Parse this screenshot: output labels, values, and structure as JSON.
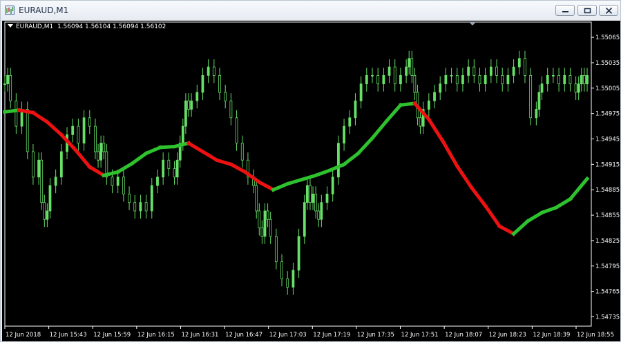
{
  "window": {
    "title": "EURAUD,M1",
    "icon": "chart-window-icon",
    "buttons": [
      "minimize",
      "restore",
      "close"
    ]
  },
  "chart_header": {
    "symbol": "EURAUD,M1",
    "ohlc": "1.56094 1.56104 1.56094 1.56102"
  },
  "colors": {
    "background": "#000000",
    "candles": "#66e066",
    "ma_up": "#2ec22e",
    "ma_down": "#ee1111",
    "axis": "#ffffff"
  },
  "chart_data": {
    "type": "line",
    "title": "",
    "xlabel": "",
    "ylabel": "",
    "ylim": [
      1.54724,
      1.55083
    ],
    "x_tick_labels": [
      "12 Jun 2018",
      "12 Jun 15:43",
      "12 Jun 15:59",
      "12 Jun 16:15",
      "12 Jun 16:31",
      "12 Jun 16:47",
      "12 Jun 17:03",
      "12 Jun 17:19",
      "12 Jun 17:35",
      "12 Jun 17:51",
      "12 Jun 18:07",
      "12 Jun 18:23",
      "12 Jun 18:39",
      "12 Jun 18:55"
    ],
    "y_tick_labels": [
      "1.55065",
      "1.55035",
      "1.55005",
      "1.54975",
      "1.54945",
      "1.54915",
      "1.54885",
      "1.54855",
      "1.54825",
      "1.54795",
      "1.54765",
      "1.54735"
    ],
    "series": [
      {
        "x": [
          0,
          2,
          4,
          8,
          12,
          16,
          20,
          24,
          26,
          28,
          30,
          32,
          36,
          40,
          44,
          48,
          52,
          56,
          60,
          64,
          66,
          68,
          70,
          72,
          76,
          80,
          84,
          88,
          92,
          96,
          100,
          104,
          108,
          112,
          116,
          120,
          122,
          124,
          126,
          128,
          130,
          132,
          136,
          140,
          144,
          148,
          152,
          156,
          160,
          164,
          168,
          172,
          176,
          178,
          180,
          182,
          184,
          186,
          188,
          192,
          196,
          200,
          204,
          208,
          212,
          214,
          216,
          218,
          220,
          222,
          224,
          228,
          232,
          236,
          240,
          244,
          248,
          252,
          256,
          260,
          264,
          268,
          272,
          276,
          280,
          284,
          286,
          288,
          290,
          292,
          294,
          296,
          300,
          304,
          308,
          312,
          316,
          320,
          324,
          328,
          332,
          336,
          340,
          344,
          348,
          352,
          356,
          360,
          364,
          368,
          372,
          376,
          378,
          380,
          384,
          388,
          392,
          396,
          400,
          404,
          406,
          408,
          410,
          412
        ],
        "values": [
          1.5501,
          1.5502,
          1.5499,
          1.5496,
          1.5498,
          1.5493,
          1.549,
          1.5492,
          1.5487,
          1.5485,
          1.5486,
          1.5489,
          1.549,
          1.5493,
          1.5495,
          1.5496,
          1.5494,
          1.5497,
          1.5496,
          1.5493,
          1.5492,
          1.5494,
          1.5493,
          1.549,
          1.5489,
          1.549,
          1.5488,
          1.5487,
          1.5486,
          1.5487,
          1.5486,
          1.5489,
          1.549,
          1.5492,
          1.5491,
          1.549,
          1.5492,
          1.5494,
          1.5496,
          1.5499,
          1.5498,
          1.5499,
          1.55,
          1.5502,
          1.5503,
          1.5502,
          1.55,
          1.5499,
          1.5497,
          1.5494,
          1.5492,
          1.549,
          1.5489,
          1.5486,
          1.5484,
          1.5483,
          1.5486,
          1.5485,
          1.5483,
          1.548,
          1.5478,
          1.5477,
          1.5479,
          1.5483,
          1.5487,
          1.5489,
          1.5487,
          1.5488,
          1.5486,
          1.5485,
          1.5487,
          1.5488,
          1.549,
          1.5494,
          1.5496,
          1.5497,
          1.5499,
          1.5501,
          1.5502,
          1.5502,
          1.5501,
          1.5502,
          1.5503,
          1.5501,
          1.5502,
          1.5503,
          1.5504,
          1.5502,
          1.55,
          1.5497,
          1.5496,
          1.5498,
          1.5499,
          1.55,
          1.5501,
          1.5502,
          1.5502,
          1.5501,
          1.5502,
          1.5503,
          1.5502,
          1.5501,
          1.5502,
          1.5503,
          1.5502,
          1.5501,
          1.5502,
          1.5503,
          1.5504,
          1.5502,
          1.5497,
          1.5498,
          1.55,
          1.5501,
          1.5502,
          1.5502,
          1.5501,
          1.5502,
          1.5501,
          1.55,
          1.5501,
          1.5502,
          1.5501,
          1.5502
        ]
      },
      {
        "x": [
          0,
          10,
          20,
          30,
          40,
          50,
          60,
          70,
          80,
          90,
          100,
          110,
          120,
          130,
          140,
          150,
          160,
          170,
          180,
          190,
          200,
          210,
          220,
          230,
          240,
          250,
          260,
          270,
          280,
          290,
          300,
          310,
          320,
          330,
          340,
          350,
          360,
          370,
          380,
          390,
          400,
          410,
          412
        ],
        "values": [
          1.54977,
          1.54979,
          1.54976,
          1.54965,
          1.5495,
          1.54932,
          1.54912,
          1.54902,
          1.54906,
          1.54916,
          1.54928,
          1.54935,
          1.54936,
          1.5494,
          1.5493,
          1.5492,
          1.54915,
          1.54906,
          1.54894,
          1.54885,
          1.54892,
          1.54897,
          1.54902,
          1.54908,
          1.54915,
          1.54928,
          1.54946,
          1.54966,
          1.54985,
          1.54987,
          1.54968,
          1.54942,
          1.54913,
          1.54888,
          1.54866,
          1.54842,
          1.54833,
          1.54848,
          1.54858,
          1.54864,
          1.54874,
          1.54894,
          1.54898
        ]
      }
    ]
  }
}
